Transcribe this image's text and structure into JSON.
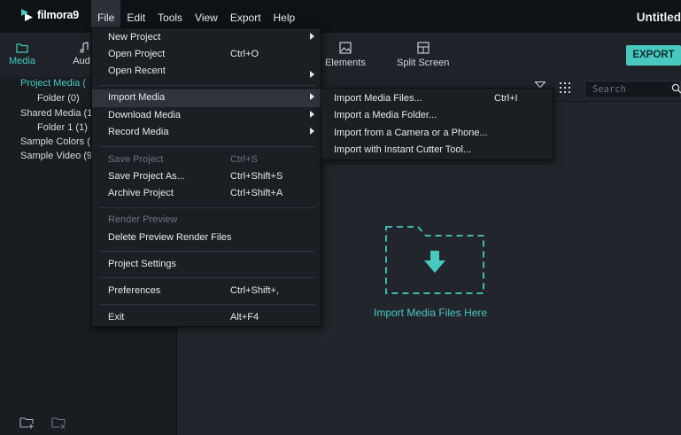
{
  "app": {
    "logo_text": "filmora9",
    "window_title": "Untitled"
  },
  "menubar": [
    "File",
    "Edit",
    "Tools",
    "View",
    "Export",
    "Help"
  ],
  "left_tabs": {
    "media": "Media",
    "audio": "Aud"
  },
  "library_tree": [
    "Project Media (",
    "Folder (0)",
    "Shared Media (1",
    "Folder 1 (1)",
    "Sample Colors (",
    "Sample Video (9"
  ],
  "top_tabs": {
    "elements": "Elements",
    "split_screen": "Split Screen"
  },
  "export_label": "EXPORT",
  "search": {
    "placeholder": "Search"
  },
  "dropzone_label": "Import Media Files Here",
  "file_menu": {
    "new_project": "New Project",
    "open_project": "Open Project",
    "open_project_sc": "Ctrl+O",
    "open_recent": "Open Recent",
    "import_media": "Import Media",
    "download_media": "Download Media",
    "record_media": "Record Media",
    "save_project": "Save Project",
    "save_project_sc": "Ctrl+S",
    "save_project_as": "Save Project As...",
    "save_project_as_sc": "Ctrl+Shift+S",
    "archive_project": "Archive Project",
    "archive_project_sc": "Ctrl+Shift+A",
    "render_preview": "Render Preview",
    "delete_preview": "Delete Preview Render Files",
    "project_settings": "Project Settings",
    "preferences": "Preferences",
    "preferences_sc": "Ctrl+Shift+,",
    "exit": "Exit",
    "exit_sc": "Alt+F4"
  },
  "import_submenu": {
    "files": "Import Media Files...",
    "files_sc": "Ctrl+I",
    "folder": "Import a Media Folder...",
    "camera": "Import from a Camera or a Phone...",
    "cutter": "Import with Instant Cutter Tool..."
  },
  "colors": {
    "accent": "#49c8c0",
    "menu_bg": "#1b1e23",
    "titlebar": "#0e1116"
  }
}
